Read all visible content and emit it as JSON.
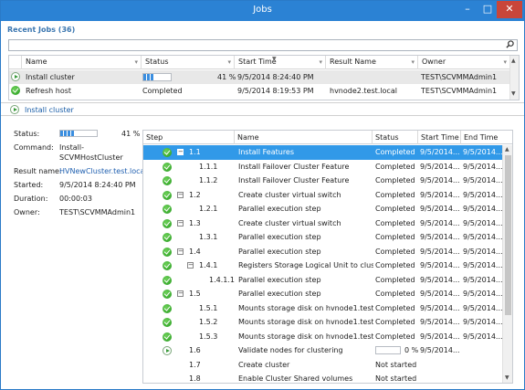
{
  "window": {
    "title": "Jobs",
    "min_glyph": "–",
    "max_glyph": "□",
    "close_glyph": "✕"
  },
  "recent_jobs_label": "Recent Jobs (36)",
  "search": {
    "value": "",
    "placeholder": "",
    "icon": "search-icon"
  },
  "jobs_grid": {
    "columns": [
      "Name",
      "Status",
      "Start Time",
      "Result Name",
      "Owner"
    ],
    "rows": [
      {
        "icon": "running",
        "name": "Install cluster",
        "status": "",
        "progress_text": "41 %",
        "progress": 41,
        "start_time": "9/5/2014 8:24:40 PM",
        "result_name": "",
        "owner": "TEST\\SCVMMAdmin1"
      },
      {
        "icon": "completed",
        "name": "Refresh host",
        "status": "Completed",
        "progress_text": "",
        "progress": null,
        "start_time": "9/5/2014 8:19:53 PM",
        "result_name": "hvnode2.test.local",
        "owner": "TEST\\SCVMMAdmin1"
      }
    ]
  },
  "details": {
    "job_title": "Install cluster",
    "labels": {
      "status": "Status:",
      "command": "Command:",
      "result_name": "Result name:",
      "started": "Started:",
      "duration": "Duration:",
      "owner": "Owner:"
    },
    "status_progress": 41,
    "status_text": "41 %",
    "command_line1": "Install-",
    "command_line2": "SCVMHostCluster",
    "result_name": "HVNewCluster.test.local",
    "started": "9/5/2014 8:24:40 PM",
    "duration": "00:00:03",
    "owner": "TEST\\SCVMMAdmin1"
  },
  "steps_grid": {
    "columns": [
      "Step",
      "Name",
      "Status",
      "Start Time",
      "End Time"
    ],
    "rows": [
      {
        "icon": "completed",
        "expander": "−",
        "indent": 0,
        "step": "1.1",
        "name": "Install Features",
        "status": "Completed",
        "start": "9/5/2014...",
        "end": "9/5/2014..."
      },
      {
        "icon": "completed",
        "expander": "",
        "indent": 1,
        "step": "1.1.1",
        "name": "Install Failover Cluster Feature",
        "status": "Completed",
        "start": "9/5/2014...",
        "end": "9/5/2014..."
      },
      {
        "icon": "completed",
        "expander": "",
        "indent": 1,
        "step": "1.1.2",
        "name": "Install Failover Cluster Feature",
        "status": "Completed",
        "start": "9/5/2014...",
        "end": "9/5/2014..."
      },
      {
        "icon": "completed",
        "expander": "−",
        "indent": 0,
        "step": "1.2",
        "name": "Create cluster virtual switch",
        "status": "Completed",
        "start": "9/5/2014...",
        "end": "9/5/2014..."
      },
      {
        "icon": "completed",
        "expander": "",
        "indent": 1,
        "step": "1.2.1",
        "name": "Parallel execution step",
        "status": "Completed",
        "start": "9/5/2014...",
        "end": "9/5/2014..."
      },
      {
        "icon": "completed",
        "expander": "−",
        "indent": 0,
        "step": "1.3",
        "name": "Create cluster virtual switch",
        "status": "Completed",
        "start": "9/5/2014...",
        "end": "9/5/2014..."
      },
      {
        "icon": "completed",
        "expander": "",
        "indent": 1,
        "step": "1.3.1",
        "name": "Parallel execution step",
        "status": "Completed",
        "start": "9/5/2014...",
        "end": "9/5/2014..."
      },
      {
        "icon": "completed",
        "expander": "−",
        "indent": 0,
        "step": "1.4",
        "name": "Parallel execution step",
        "status": "Completed",
        "start": "9/5/2014...",
        "end": "9/5/2014..."
      },
      {
        "icon": "completed",
        "expander": "−",
        "indent": 1,
        "step": "1.4.1",
        "name": "Registers Storage Logical Unit to cluster...",
        "status": "Completed",
        "start": "9/5/2014...",
        "end": "9/5/2014..."
      },
      {
        "icon": "completed",
        "expander": "",
        "indent": 2,
        "step": "1.4.1.1",
        "name": "Parallel execution step",
        "status": "Completed",
        "start": "9/5/2014...",
        "end": "9/5/2014..."
      },
      {
        "icon": "completed",
        "expander": "−",
        "indent": 0,
        "step": "1.5",
        "name": "Parallel execution step",
        "status": "Completed",
        "start": "9/5/2014...",
        "end": "9/5/2014..."
      },
      {
        "icon": "completed",
        "expander": "",
        "indent": 1,
        "step": "1.5.1",
        "name": "Mounts storage disk on hvnode1.test.lo...",
        "status": "Completed",
        "start": "9/5/2014...",
        "end": "9/5/2014..."
      },
      {
        "icon": "completed",
        "expander": "",
        "indent": 1,
        "step": "1.5.2",
        "name": "Mounts storage disk on hvnode1.test.lo...",
        "status": "Completed",
        "start": "9/5/2014...",
        "end": "9/5/2014..."
      },
      {
        "icon": "completed",
        "expander": "",
        "indent": 1,
        "step": "1.5.3",
        "name": "Mounts storage disk on hvnode1.test.lo...",
        "status": "Completed",
        "start": "9/5/2014...",
        "end": "9/5/2014..."
      },
      {
        "icon": "running",
        "expander": "",
        "indent": 0,
        "step": "1.6",
        "name": "Validate nodes for clustering",
        "status": "",
        "progress": 0,
        "progress_text": "0 %",
        "start": "9/5/2014...",
        "end": ""
      },
      {
        "icon": "",
        "expander": "",
        "indent": 0,
        "step": "1.7",
        "name": "Create cluster",
        "status": "Not started",
        "start": "",
        "end": ""
      },
      {
        "icon": "",
        "expander": "",
        "indent": 0,
        "step": "1.8",
        "name": "Enable Cluster Shared volumes",
        "status": "Not started",
        "start": "",
        "end": ""
      }
    ]
  }
}
